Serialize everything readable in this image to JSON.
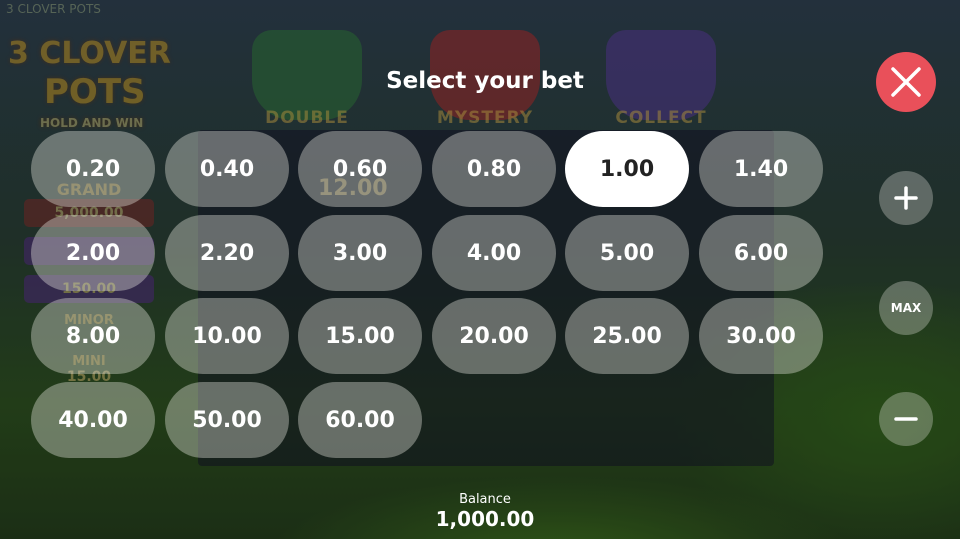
{
  "dialog": {
    "title": "Select your bet"
  },
  "bets": [
    "0.20",
    "0.40",
    "0.60",
    "0.80",
    "1.00",
    "1.40",
    "2.00",
    "2.20",
    "3.00",
    "4.00",
    "5.00",
    "6.00",
    "8.00",
    "10.00",
    "15.00",
    "20.00",
    "25.00",
    "30.00",
    "40.00",
    "50.00",
    "60.00"
  ],
  "selected_bet": "1.00",
  "controls": {
    "max_label": "MAX"
  },
  "balance": {
    "label": "Balance",
    "value": "1,000.00"
  },
  "background": {
    "game_name": "3 CLOVER POTS",
    "logo_line1": "3 CLOVER",
    "logo_line2": "POTS",
    "logo_tagline": "HOLD AND WIN",
    "pots": [
      "DOUBLE",
      "MYSTERY",
      "COLLECT"
    ],
    "jackpots": [
      "GRAND",
      "MINOR",
      "MINI"
    ],
    "jackpot_values": [
      "5,000.00",
      "150.00",
      "15.00"
    ],
    "reel_value": "12.00"
  },
  "colors": {
    "close_button": "#e9505a",
    "selected_bet_bg": "#ffffff",
    "bet_bg": "rgba(235,235,225,0.38)"
  }
}
